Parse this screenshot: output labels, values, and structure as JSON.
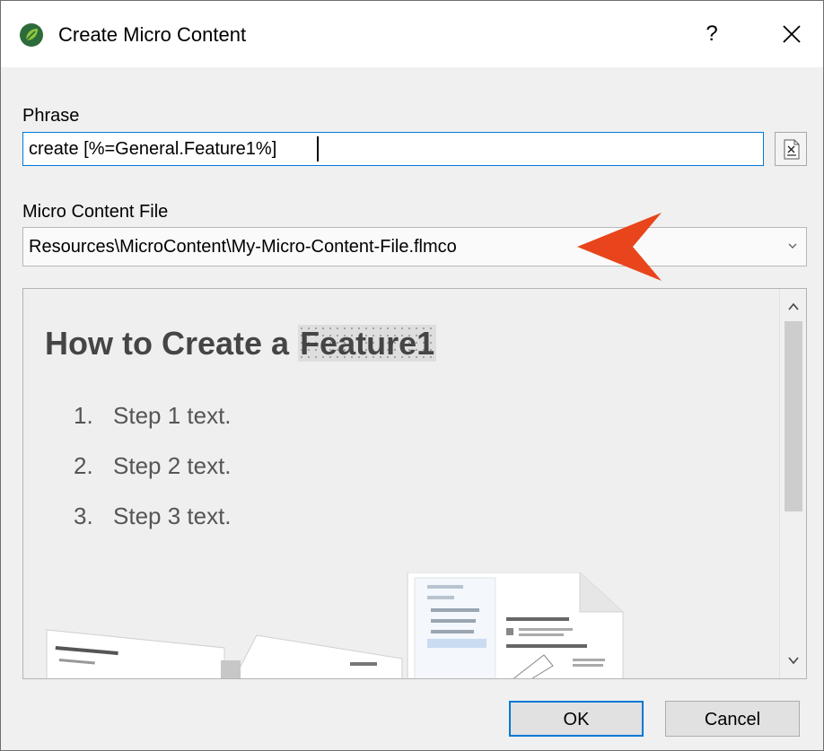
{
  "window": {
    "title": "Create Micro Content",
    "help_label": "?",
    "app_icon": "flare-leaf-icon"
  },
  "phrase": {
    "label": "Phrase",
    "value": "create [%=General.Feature1%]",
    "insert_variable_icon": "insert-variable-icon"
  },
  "micro_content_file": {
    "label": "Micro Content File",
    "selected": "Resources\\MicroContent\\My-Micro-Content-File.flmco"
  },
  "annotation": {
    "arrow_color": "#e8451c"
  },
  "preview": {
    "heading_prefix": "How to Create a ",
    "heading_variable": "Feature1",
    "steps": [
      {
        "num": "1.",
        "text": "Step 1 text."
      },
      {
        "num": "2.",
        "text": "Step 2 text."
      },
      {
        "num": "3.",
        "text": "Step 3 text."
      }
    ]
  },
  "buttons": {
    "ok": "OK",
    "cancel": "Cancel"
  },
  "colors": {
    "accent": "#0078d7",
    "heading": "#454545",
    "step_text": "#555555"
  }
}
